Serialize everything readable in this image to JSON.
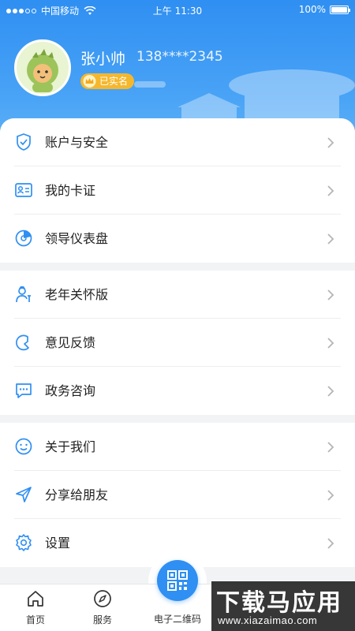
{
  "status_bar": {
    "carrier": "中国移动",
    "time": "上午 11:30",
    "battery": "100%",
    "battery_level": 1.0
  },
  "profile": {
    "name": "张小帅",
    "phone": "138****2345",
    "badge": "已实名"
  },
  "menu_groups": [
    [
      {
        "label": "账户与安全",
        "icon": "shield-check-icon"
      },
      {
        "label": "我的卡证",
        "icon": "id-card-icon"
      },
      {
        "label": "领导仪表盘",
        "icon": "dashboard-icon"
      }
    ],
    [
      {
        "label": "老年关怀版",
        "icon": "elderly-icon"
      },
      {
        "label": "意见反馈",
        "icon": "feedback-icon"
      },
      {
        "label": "政务咨询",
        "icon": "chat-icon"
      }
    ],
    [
      {
        "label": "关于我们",
        "icon": "smile-icon"
      },
      {
        "label": "分享给朋友",
        "icon": "share-icon"
      },
      {
        "label": "设置",
        "icon": "gear-icon"
      }
    ]
  ],
  "tabs": {
    "home": "首页",
    "service": "服务",
    "qrcode": "电子二维码"
  },
  "watermark": {
    "title": "下载马应用",
    "url": "www.xiazaimao.com"
  },
  "colors": {
    "primary": "#2f8ff2",
    "badge": "#f5b72d"
  }
}
